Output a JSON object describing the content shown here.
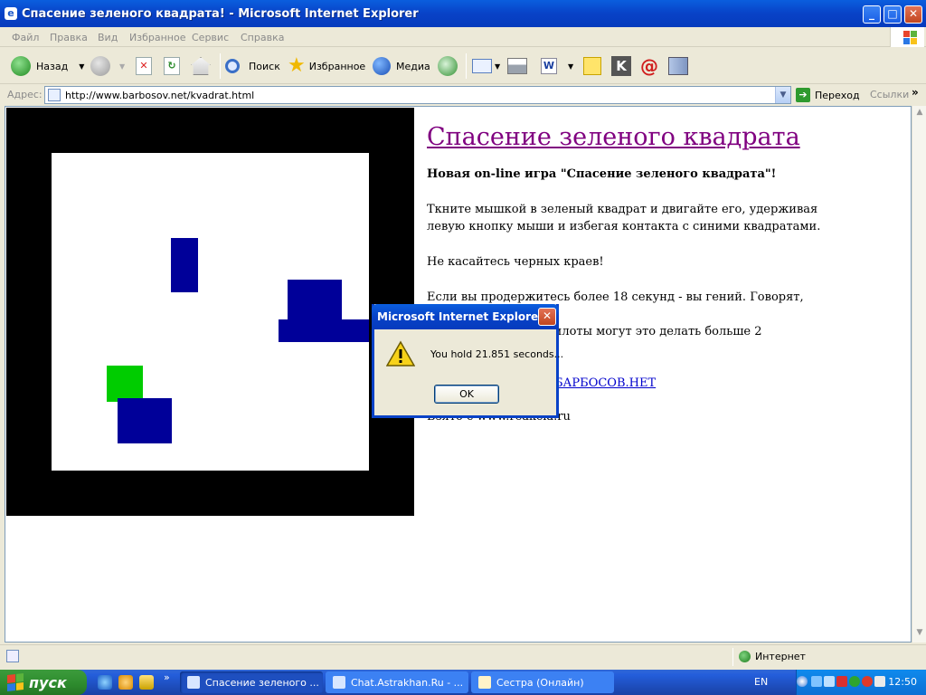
{
  "window": {
    "title": "Спасение зеленого квадрата! - Microsoft Internet Explorer"
  },
  "menu": [
    "Файл",
    "Правка",
    "Вид",
    "Избранное",
    "Сервис",
    "Справка"
  ],
  "toolbar": {
    "back": "Назад",
    "search": "Поиск",
    "favorites": "Избранное",
    "media": "Медиа"
  },
  "address": {
    "label": "Адрес:",
    "url": "http://www.barbosov.net/kvadrat.html",
    "go": "Переход",
    "links": "Ссылки"
  },
  "page": {
    "heading": "Спасение зеленого квадрата",
    "subtitle": "Новая on-line игра \"Спасение зеленого квадрата\"!",
    "instructions": "Ткните мышкой в зеленый квадрат и двигайте его, удерживая левую кнопку мыши и избегая контакта с синими квадратами.",
    "warning": "Не касайтесь черных краев!",
    "genius_pre": "Если вы продержитесь более 18 секунд - вы гений. Говорят, что",
    "genius_post": "пилоты могут это делать больше 2",
    "link": "БАРБОСОВ.НЕТ",
    "source": "Взято с www.reakcia.ru"
  },
  "game": {
    "colors": {
      "border": "#000000",
      "field": "#ffffff",
      "enemy": "#000099",
      "player": "#00cc00"
    }
  },
  "dialog": {
    "title": "Microsoft Internet Explorer",
    "message": "You hold 21.851 seconds...",
    "ok": "OK"
  },
  "status": {
    "zone": "Интернет"
  },
  "taskbar": {
    "start": "пуск",
    "tasks": [
      "Спасение зеленого ...",
      "Chat.Astrakhan.Ru - ...",
      "Сестра (Онлайн)"
    ],
    "lang": "EN",
    "clock": "12:50"
  }
}
